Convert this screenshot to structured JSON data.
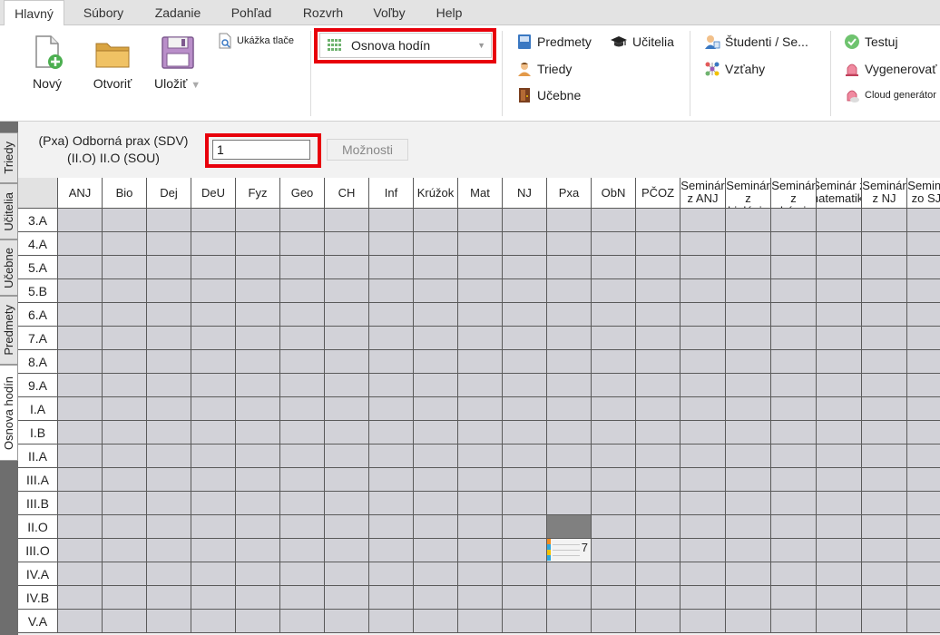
{
  "menu": [
    "Hlavný",
    "Súbory",
    "Zadanie",
    "Pohľad",
    "Rozvrh",
    "Voľby",
    "Help"
  ],
  "ribbon": {
    "new_label": "Nový",
    "open_label": "Otvoriť",
    "save_label": "Uložiť",
    "print_preview_label": "Ukážka tlače",
    "view_select": "Osnova hodín",
    "subjects_label": "Predmety",
    "teachers_label": "Učitelia",
    "classes_label": "Triedy",
    "classrooms_label": "Učebne",
    "students_label": "Študenti / Se...",
    "relations_label": "Vzťahy",
    "test_label": "Testuj",
    "generate_label": "Vygenerovať",
    "cloud_label": "Cloud generátor"
  },
  "side_tabs": [
    "Triedy",
    "Učitelia",
    "Učebne",
    "Predmety",
    "Osnova hodín"
  ],
  "toolbar": {
    "subject_line1": "(Pxa) Odborná prax (SDV)",
    "subject_line2": "(II.O) II.O (SOU)",
    "count_value": "1",
    "options_label": "Možnosti"
  },
  "grid": {
    "columns": [
      "ANJ",
      "Bio",
      "Dej",
      "DeU",
      "Fyz",
      "Geo",
      "CH",
      "Inf",
      "Krúžok",
      "Mat",
      "NJ",
      "Pxa",
      "ObN",
      "PČOZ",
      "Seminár z ANJ",
      "Seminár z biológie",
      "Seminár z chémie",
      "Seminár z matematiky",
      "Seminár z NJ",
      "Seminár zo SJL"
    ],
    "rows": [
      "3.A",
      "4.A",
      "5.A",
      "5.B",
      "6.A",
      "7.A",
      "8.A",
      "9.A",
      "I.A",
      "I.B",
      "II.A",
      "III.A",
      "III.B",
      "II.O",
      "III.O",
      "IV.A",
      "IV.B",
      "V.A"
    ],
    "assignments": [
      {
        "row": "II.O",
        "col": "Pxa",
        "state": "selected",
        "count": ""
      },
      {
        "row": "III.O",
        "col": "Pxa",
        "state": "assigned",
        "count": "7"
      }
    ],
    "assign_colors": [
      "#f28c1e",
      "#2aa7df",
      "#f2c200",
      "#2aa7df"
    ]
  },
  "colors": {
    "highlight_border": "#e8000b",
    "cell_bg": "#d2d2d8",
    "selected_bg": "#808080"
  }
}
